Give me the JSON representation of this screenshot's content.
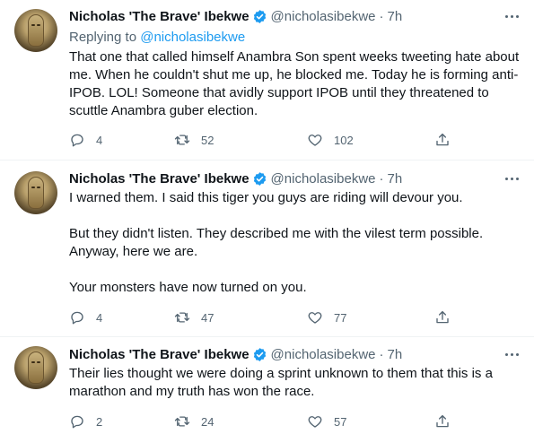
{
  "colors": {
    "text": "#0f1419",
    "secondary": "#536471",
    "accent": "#1d9bf0",
    "divider": "#eff3f4"
  },
  "tweets": [
    {
      "name": "Nicholas 'The Brave' Ibekwe",
      "handle": "@nicholasibekwe",
      "dot": "·",
      "time": "7h",
      "replying_label": "Replying to",
      "replying_handle": "@nicholasibekwe",
      "paragraphs": [
        "That one that called himself Anambra Son spent weeks tweeting hate about me. When he couldn't shut me up, he blocked me. Today he is forming anti-IPOB. LOL! Someone that avidly support IPOB until they threatened to scuttle Anambra guber election."
      ],
      "replies": "4",
      "retweets": "52",
      "likes": "102"
    },
    {
      "name": "Nicholas 'The Brave' Ibekwe",
      "handle": "@nicholasibekwe",
      "dot": "·",
      "time": "7h",
      "paragraphs": [
        "I warned them. I said this tiger you guys are riding will devour you.",
        "But they didn't listen. They described me with the vilest term possible. Anyway, here we are.",
        "Your monsters have now turned on you."
      ],
      "replies": "4",
      "retweets": "47",
      "likes": "77"
    },
    {
      "name": "Nicholas 'The Brave' Ibekwe",
      "handle": "@nicholasibekwe",
      "dot": "·",
      "time": "7h",
      "paragraphs": [
        "Their lies thought we were doing a sprint unknown to them that this is a marathon and my truth has won the race."
      ],
      "replies": "2",
      "retweets": "24",
      "likes": "57"
    }
  ]
}
